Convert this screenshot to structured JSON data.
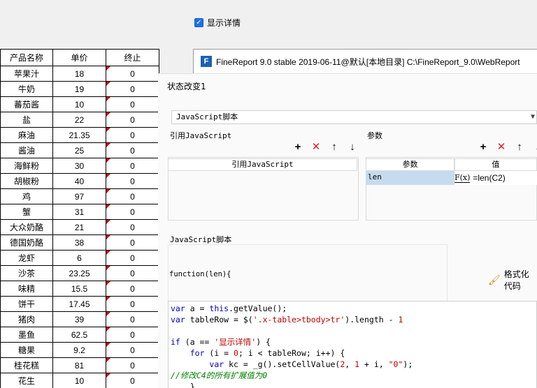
{
  "checkbox": {
    "label": "显示详情",
    "checked": true
  },
  "table": {
    "headers": [
      "产品名称",
      "单价",
      "终止"
    ],
    "rows": [
      [
        "苹果汁",
        "18",
        "0"
      ],
      [
        "牛奶",
        "19",
        "0"
      ],
      [
        "蕃茄酱",
        "10",
        "0"
      ],
      [
        "盐",
        "22",
        "0"
      ],
      [
        "麻油",
        "21.35",
        "0"
      ],
      [
        "酱油",
        "25",
        "0"
      ],
      [
        "海鲜粉",
        "30",
        "0"
      ],
      [
        "胡椒粉",
        "40",
        "0"
      ],
      [
        "鸡",
        "97",
        "0"
      ],
      [
        "蟹",
        "31",
        "0"
      ],
      [
        "大众奶酪",
        "21",
        "0"
      ],
      [
        "德国奶酪",
        "38",
        "0"
      ],
      [
        "龙虾",
        "6",
        "0"
      ],
      [
        "沙茶",
        "23.25",
        "0"
      ],
      [
        "味精",
        "15.5",
        "0"
      ],
      [
        "饼干",
        "17.45",
        "0"
      ],
      [
        "猪肉",
        "39",
        "0"
      ],
      [
        "墨鱼",
        "62.5",
        "0"
      ],
      [
        "糖果",
        "9.2",
        "0"
      ],
      [
        "桂花糕",
        "81",
        "0"
      ],
      [
        "花生",
        "10",
        "0"
      ]
    ]
  },
  "window": {
    "title": "FineReport 9.0 stable 2019-06-11@默认[本地目录]    C:\\FineReport_9.0\\WebReport"
  },
  "panel": {
    "title": "状态改变1",
    "type_select": "JavaScript脚本",
    "ref_js_label": "引用JavaScript",
    "ref_js_column": "引用JavaScript",
    "params_label": "参数",
    "params_col_name": "参数",
    "params_col_value": "值",
    "param_name": "len",
    "param_value": "=len(C2)",
    "js_label": "JavaScript脚本",
    "func_header": "function(len){",
    "format_button": "格式化代码"
  },
  "icons": {
    "add": "plus-icon",
    "delete": "delete-icon",
    "up": "arrow-up-icon",
    "down": "arrow-down-icon",
    "brush": "brush-icon"
  }
}
